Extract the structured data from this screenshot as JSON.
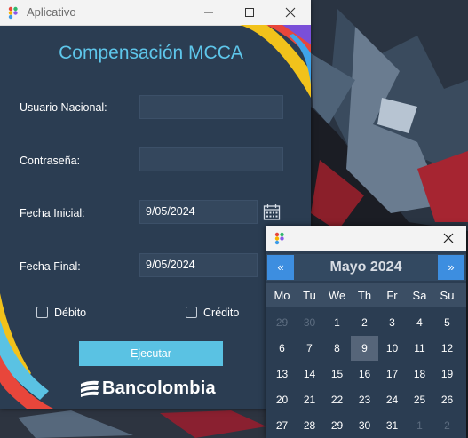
{
  "window": {
    "title": "Aplicativo"
  },
  "form": {
    "heading": "Compensación MCCA",
    "usuario_label": "Usuario Nacional:",
    "usuario_value": "",
    "password_label": "Contraseña:",
    "password_value": "",
    "fecha_inicial_label": "Fecha Inicial:",
    "fecha_inicial_value": "9/05/2024",
    "fecha_final_label": "Fecha Final:",
    "fecha_final_value": "9/05/2024",
    "debito_label": "Débito",
    "debito_checked": false,
    "credito_label": "Crédito",
    "credito_checked": false,
    "execute_label": "Ejecutar",
    "brand": "Bancolombia"
  },
  "calendar": {
    "prev_label": "«",
    "next_label": "»",
    "month_title": "Mayo 2024",
    "weekdays": [
      "Mo",
      "Tu",
      "We",
      "Th",
      "Fr",
      "Sa",
      "Su"
    ],
    "weeks": [
      [
        "29",
        "30",
        "1",
        "2",
        "3",
        "4",
        "5"
      ],
      [
        "6",
        "7",
        "8",
        "9",
        "10",
        "11",
        "12"
      ],
      [
        "13",
        "14",
        "15",
        "16",
        "17",
        "18",
        "19"
      ],
      [
        "20",
        "21",
        "22",
        "23",
        "24",
        "25",
        "26"
      ],
      [
        "27",
        "28",
        "29",
        "30",
        "31",
        "1",
        "2"
      ]
    ],
    "muted_days": [
      [
        0,
        0
      ],
      [
        0,
        1
      ],
      [
        4,
        5
      ],
      [
        4,
        6
      ]
    ],
    "selected_day": "9"
  },
  "colors": {
    "window_bg": "#2b3d52",
    "accent_title": "#5ec6ea",
    "button_bg": "#5ac2e3",
    "nav_button": "#3d8ee0"
  },
  "icons": [
    "app-icon",
    "minimize-icon",
    "maximize-icon",
    "close-icon",
    "calendar-icon",
    "bancolombia-logo-icon"
  ]
}
